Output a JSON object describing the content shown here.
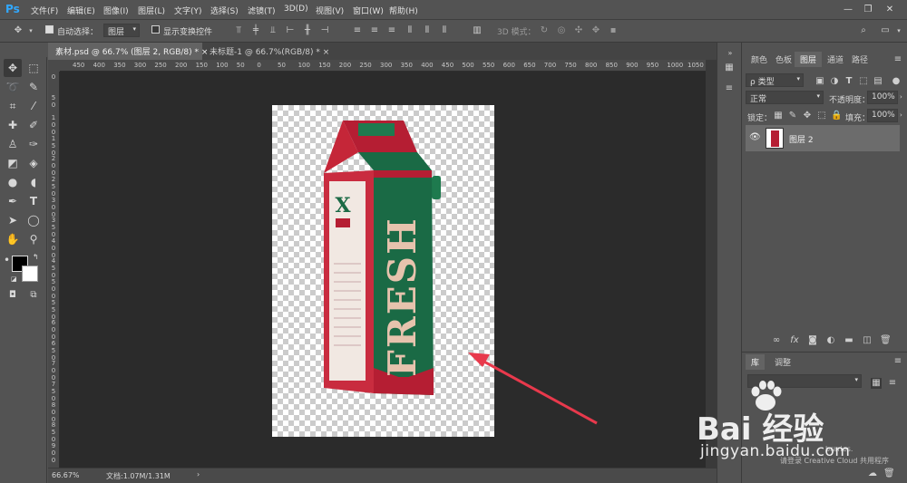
{
  "app": {
    "logo": "Ps"
  },
  "menus": [
    "文件(F)",
    "编辑(E)",
    "图像(I)",
    "图层(L)",
    "文字(Y)",
    "选择(S)",
    "滤镜(T)",
    "3D(D)",
    "视图(V)",
    "窗口(W)",
    "帮助(H)"
  ],
  "options": {
    "auto_select_label": "自动选择：",
    "auto_select_value": "图层",
    "show_transform_label": "显示变换控件",
    "mode_3d_label": "3D 模式："
  },
  "tabs": [
    {
      "label": "素材.psd @ 66.7% (图层 2, RGB/8) *",
      "close": "×"
    },
    {
      "label": "未标题-1 @ 66.7%(RGB/8) *",
      "close": "×"
    }
  ],
  "hruler": [
    "450",
    "400",
    "350",
    "300",
    "250",
    "200",
    "150",
    "100",
    "50",
    "0",
    "50",
    "100",
    "150",
    "200",
    "250",
    "300",
    "350",
    "400",
    "450",
    "500",
    "550",
    "600",
    "650",
    "700",
    "750",
    "800",
    "850",
    "900",
    "950",
    "1000",
    "1050"
  ],
  "vruler": [
    "0",
    "5\n0",
    "1\n0\n0",
    "1\n5\n0",
    "2\n0\n0",
    "2\n5\n0",
    "3\n0\n0",
    "3\n5\n0",
    "4\n0\n0",
    "4\n5\n0",
    "5\n0\n0",
    "5\n5\n0",
    "6\n0\n0",
    "6\n5\n0",
    "7\n0\n0",
    "7\n5\n0",
    "8\n0\n0",
    "8\n5\n0",
    "9\n0\n0"
  ],
  "product": {
    "brand_text": "FRESH",
    "logo_letter": "X"
  },
  "status": {
    "zoom": "66.67%",
    "doc": "文档:1.07M/1.31M"
  },
  "panel": {
    "tabs": [
      "颜色",
      "色板",
      "图层",
      "通道",
      "路径"
    ],
    "filter_label": "ρ 类型",
    "blend_mode": "正常",
    "opacity_label": "不透明度：",
    "opacity_value": "100%",
    "lock_label": "锁定：",
    "fill_label": "填充：",
    "fill_value": "100%",
    "layer_name": "图层 2"
  },
  "libraries": {
    "tabs": [
      "库",
      "调整"
    ],
    "hint": "请登录 Creative Cloud 共用程序",
    "hint2": "braries."
  },
  "watermark": {
    "text": "Bai 经验",
    "url": "jingyan.baidu.com"
  },
  "colors": {
    "accent": "#31a8ff",
    "arrow": "#e8394c"
  }
}
